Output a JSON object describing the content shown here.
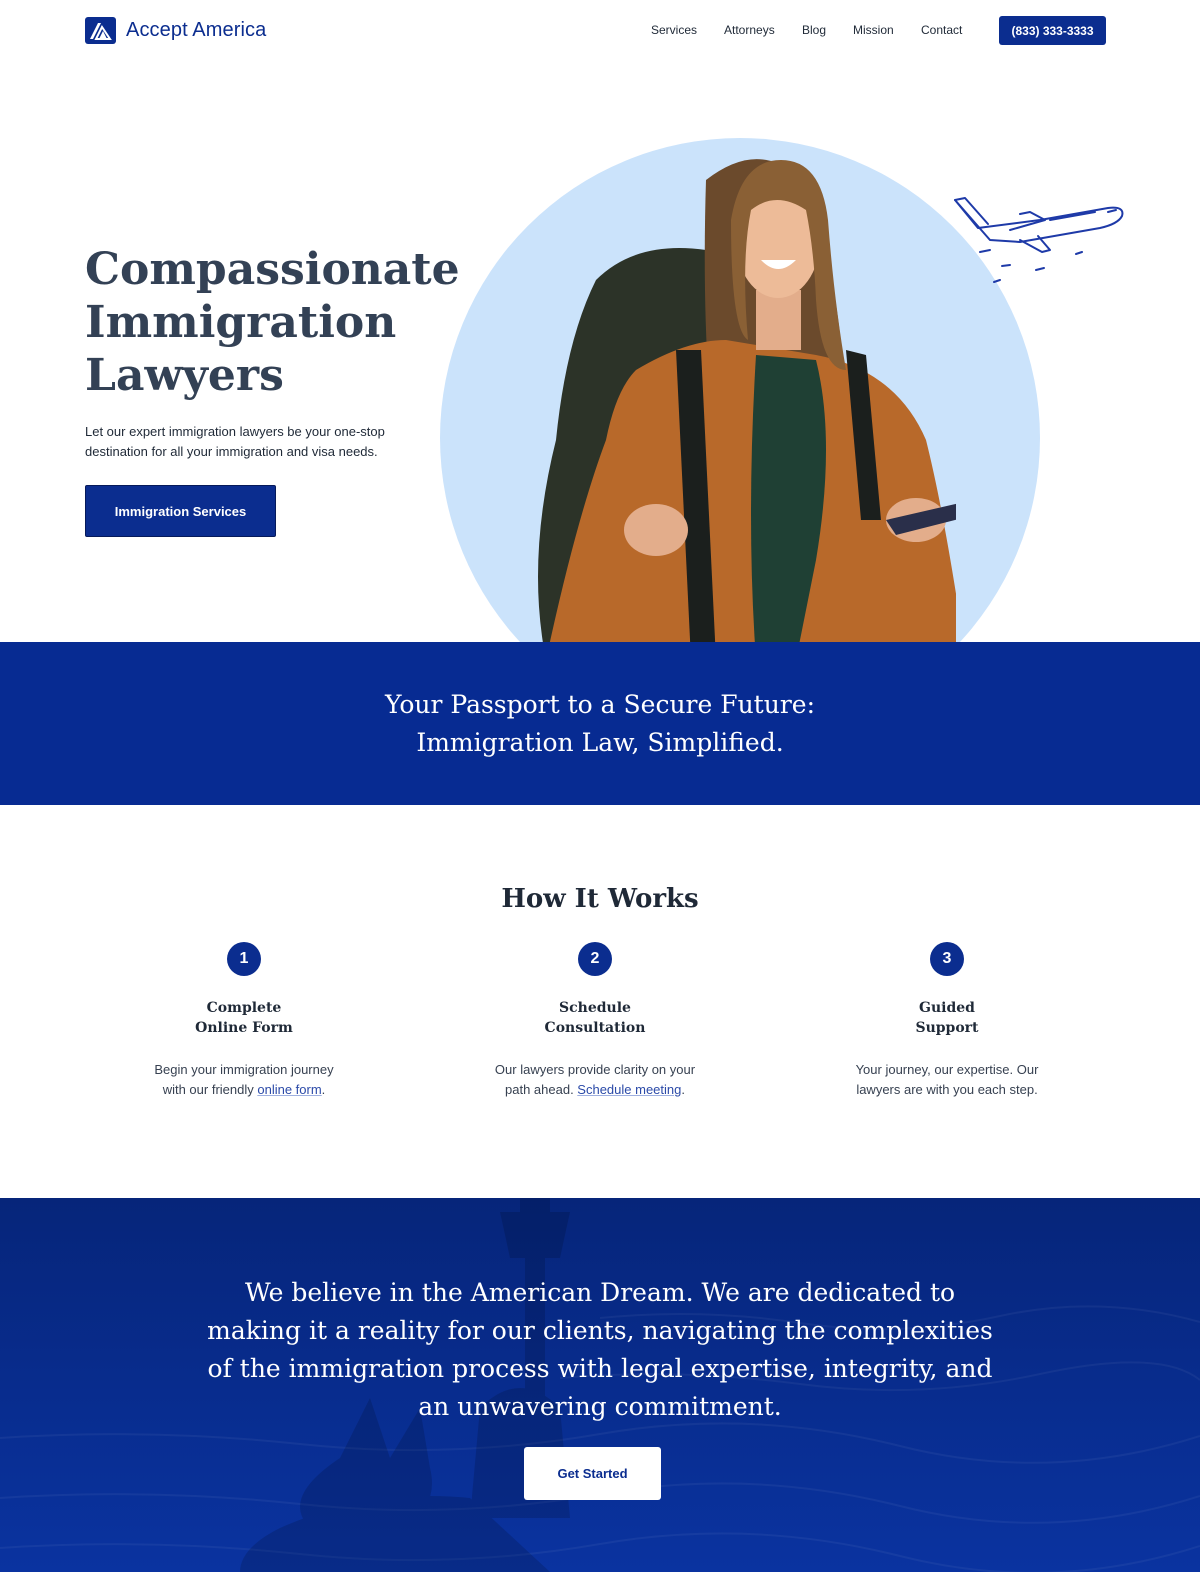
{
  "brand": {
    "name": "Accept America",
    "color": "#0b2d8f"
  },
  "nav": {
    "items": [
      "Services",
      "Attorneys",
      "Blog",
      "Mission",
      "Contact"
    ],
    "phone": "(833) 333-3333"
  },
  "hero": {
    "title": "Compassionate Immigration Lawyers",
    "description": "Let our expert immigration lawyers be your one-stop destination for all your immigration and visa needs.",
    "cta": "Immigration Services"
  },
  "banner": {
    "line1": "Your Passport to a Secure Future:",
    "line2": "Immigration Law, Simplified."
  },
  "how": {
    "title": "How It Works",
    "steps": [
      {
        "num": "1",
        "title1": "Complete",
        "title2": "Online Form",
        "desc_before": "Begin your immigration journey with our friendly ",
        "link": "online form",
        "desc_after": "."
      },
      {
        "num": "2",
        "title1": "Schedule",
        "title2": "Consultation",
        "desc_before": "Our lawyers provide clarity on your path ahead. ",
        "link": "Schedule meeting",
        "desc_after": "."
      },
      {
        "num": "3",
        "title1": "Guided",
        "title2": "Support",
        "desc_before": "Your journey, our expertise. Our lawyers are with you each step.",
        "link": "",
        "desc_after": ""
      }
    ]
  },
  "mission": {
    "text": "We believe in the American Dream. We are dedicated to making it a reality for our clients, navigating the complexities of the immigration process with legal expertise, integrity, and an unwavering commitment.",
    "cta": "Get Started"
  },
  "icons": {
    "logo": "logo-mark-icon",
    "plane": "airplane-icon",
    "statue": "statue-of-liberty-icon"
  }
}
